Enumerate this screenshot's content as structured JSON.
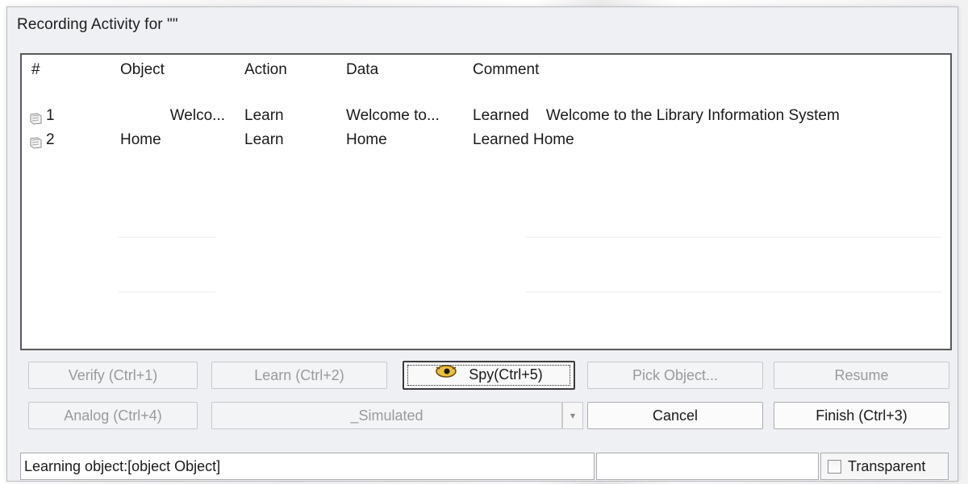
{
  "window": {
    "title": "Recording Activity for \"\""
  },
  "table": {
    "headers": {
      "num": "#",
      "object": "Object",
      "action": "Action",
      "data": "Data",
      "comment": "Comment"
    },
    "rows": [
      {
        "num": "1",
        "object": "Welco...",
        "action": "Learn",
        "data": "Welcome to...",
        "comment": "Learned    Welcome to the Library Information System",
        "icon": "record-icon"
      },
      {
        "num": "2",
        "object": "Home",
        "action": "Learn",
        "data": "Home",
        "comment": "Learned Home",
        "icon": "record-icon"
      }
    ]
  },
  "buttons": {
    "verify": "Verify (Ctrl+1)",
    "learn": "Learn (Ctrl+2)",
    "spy": "Spy(Ctrl+5)",
    "pick_object": "Pick Object...",
    "resume": "Resume",
    "analog": "Analog (Ctrl+4)",
    "simulated": "_Simulated",
    "cancel": "Cancel",
    "finish": "Finish (Ctrl+3)"
  },
  "status": {
    "message": "Learning object:[object Object]",
    "transparent_label": "Transparent",
    "transparent_checked": false
  },
  "icons": {
    "spy": "spy-eye-icon",
    "row": "record-icon",
    "dropdown": "chevron-down-icon"
  }
}
